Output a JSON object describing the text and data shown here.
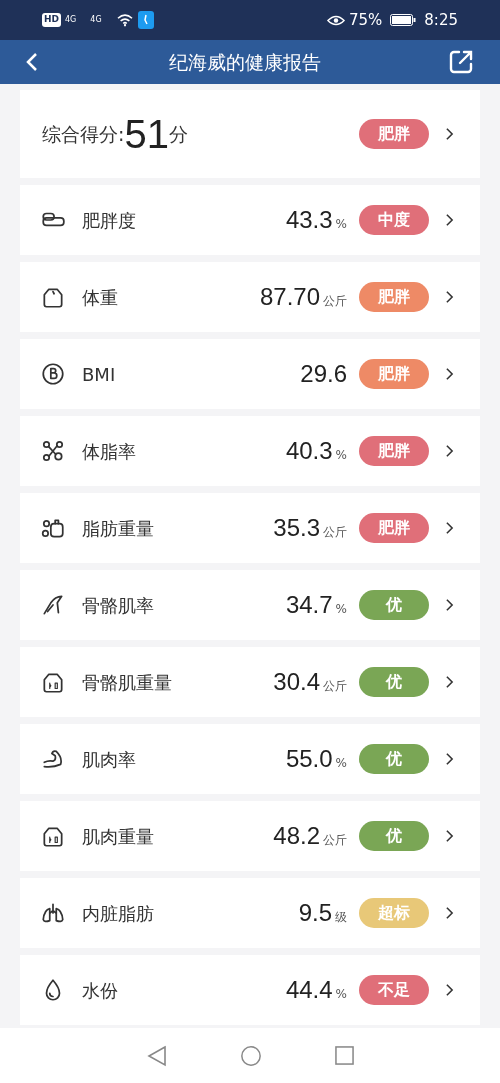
{
  "status_bar": {
    "left": [
      "HD",
      "4G",
      "4G"
    ],
    "battery": "75%",
    "time": "8:25"
  },
  "header": {
    "title": "纪海威的健康报告"
  },
  "score": {
    "label": "综合得分:",
    "value": "51",
    "unit": "分",
    "badge": "肥胖",
    "color": "#e06f79"
  },
  "metrics": [
    {
      "kind": "fatness",
      "name": "肥胖度",
      "value": "43.3",
      "unit": "%",
      "badge": "中度",
      "color": "#e06f79"
    },
    {
      "kind": "weight",
      "name": "体重",
      "value": "87.70",
      "unit": "公斤",
      "badge": "肥胖",
      "color": "#ee8a66"
    },
    {
      "kind": "bmi",
      "name": "BMI",
      "value": "29.6",
      "badge": "肥胖",
      "color": "#ee8a66"
    },
    {
      "kind": "fatrate",
      "name": "体脂率",
      "value": "40.3",
      "unit": "%",
      "badge": "肥胖",
      "color": "#e06f79"
    },
    {
      "kind": "fatmass",
      "name": "脂肪重量",
      "value": "35.3",
      "unit": "公斤",
      "badge": "肥胖",
      "color": "#e06f79"
    },
    {
      "kind": "skeletal",
      "name": "骨骼肌率",
      "value": "34.7",
      "unit": "%",
      "badge": "优",
      "color": "#7aa655"
    },
    {
      "kind": "mass",
      "name": "骨骼肌重量",
      "value": "30.4",
      "unit": "公斤",
      "badge": "优",
      "color": "#7aa655"
    },
    {
      "kind": "muscle",
      "name": "肌肉率",
      "value": "55.0",
      "unit": "%",
      "badge": "优",
      "color": "#7aa655"
    },
    {
      "kind": "mass",
      "name": "肌肉重量",
      "value": "48.2",
      "unit": "公斤",
      "badge": "优",
      "color": "#7aa655"
    },
    {
      "kind": "visceral",
      "name": "内脏脂肪",
      "value": "9.5",
      "unit": "级",
      "badge": "超标",
      "color": "#e8c878"
    },
    {
      "kind": "water",
      "name": "水份",
      "value": "44.4",
      "unit": "%",
      "badge": "不足",
      "color": "#e06f79"
    }
  ]
}
